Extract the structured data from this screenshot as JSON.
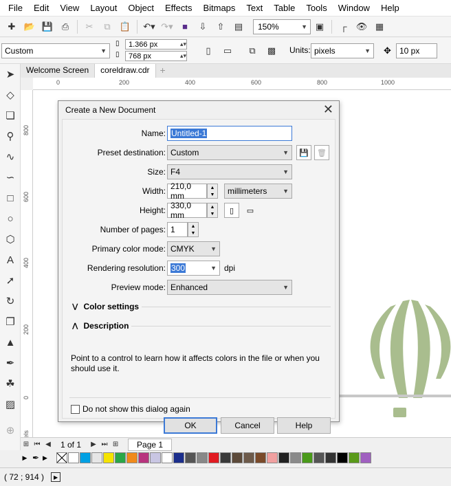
{
  "menu": [
    "File",
    "Edit",
    "View",
    "Layout",
    "Object",
    "Effects",
    "Bitmaps",
    "Text",
    "Table",
    "Tools",
    "Window",
    "Help"
  ],
  "toolbar": {
    "zoom": "150%"
  },
  "property_bar": {
    "preset": "Custom",
    "width": "1.366 px",
    "height": "768 px",
    "units_label": "Units:",
    "units": "pixels",
    "nudge": "10 px"
  },
  "tabs": {
    "welcome": "Welcome Screen",
    "document": "coreldraw.cdr",
    "add": "+"
  },
  "hruler": [
    "0",
    "200",
    "400",
    "600",
    "800",
    "1000"
  ],
  "vruler": [
    "800",
    "600",
    "400",
    "200",
    "0"
  ],
  "vruler_unit": "pixels",
  "dialog": {
    "title": "Create a New Document",
    "name_label": "Name:",
    "name_value": "Untitled-1",
    "preset_label": "Preset destination:",
    "preset_value": "Custom",
    "size_label": "Size:",
    "size_value": "F4",
    "width_label": "Width:",
    "width_value": "210,0 mm",
    "units_value": "millimeters",
    "height_label": "Height:",
    "height_value": "330,0 mm",
    "pages_label": "Number of pages:",
    "pages_value": "1",
    "color_mode_label": "Primary color mode:",
    "color_mode_value": "CMYK",
    "resolution_label": "Rendering resolution:",
    "resolution_value": "300",
    "resolution_unit": "dpi",
    "preview_label": "Preview mode:",
    "preview_value": "Enhanced",
    "color_settings": "Color settings",
    "description_heading": "Description",
    "description_text": "Point to a control to learn how it affects colors in the file or when you should use it.",
    "dont_show": "Do not show this dialog again",
    "ok": "OK",
    "cancel": "Cancel",
    "help": "Help"
  },
  "page_nav": {
    "position": "1 of 1",
    "page_tab": "Page 1"
  },
  "palette": [
    "#ffffff",
    "#00a0e3",
    "#e6e6e6",
    "#f5e300",
    "#2aa748",
    "#f08a1c",
    "#b8347e",
    "#c9c6e3",
    "#ffffff",
    "#1b2e8c",
    "#555555",
    "#888888",
    "#e11b22",
    "#3a3a3a",
    "#5c4a3a",
    "#6d5a4a",
    "#7a4a2a",
    "#f0a0a0",
    "#222222",
    "#8a8a8a",
    "#4a9a1a",
    "#555555",
    "#333333",
    "#000000",
    "#5a9a1a",
    "#a060c0"
  ],
  "status": {
    "coords": "( 72  ; 914  )"
  },
  "colors": {
    "balloon": "#a9bd8e",
    "accent": "#3b79d6"
  }
}
